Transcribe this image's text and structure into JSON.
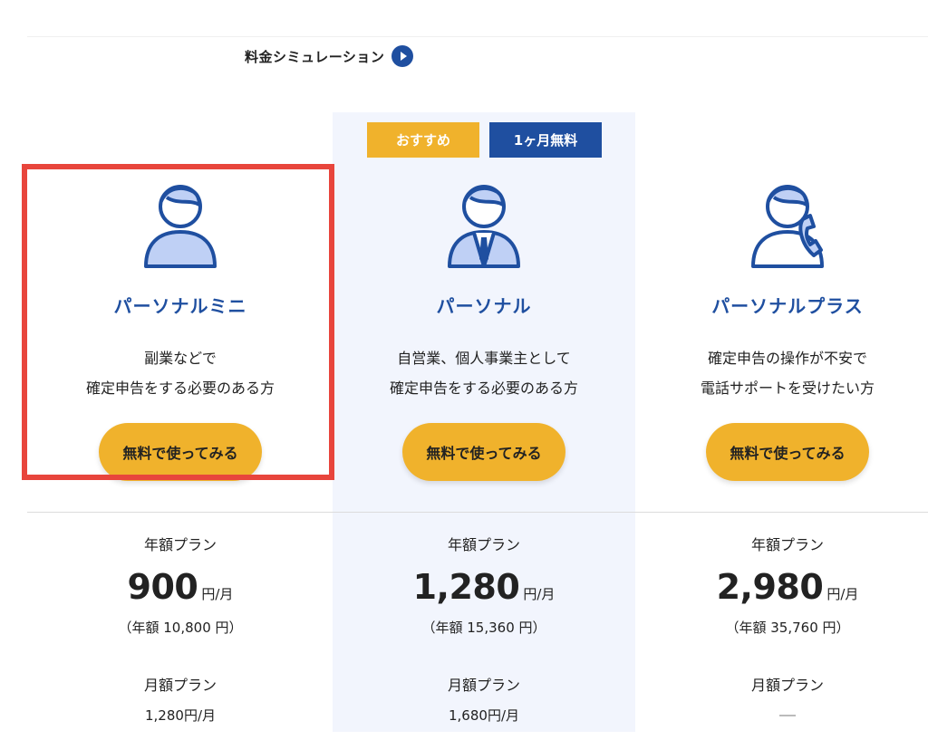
{
  "header": {
    "simulation_link": "料金シミュレーション",
    "icon": "play-circle-icon"
  },
  "badges": {
    "recommended": "おすすめ",
    "free_month": "1ヶ月無料"
  },
  "colors": {
    "brand_blue": "#1f4fa0",
    "accent_yellow": "#f0b22c",
    "highlight_red": "#e8453c",
    "highlight_bg": "#f2f5fd"
  },
  "plans": [
    {
      "name": "パーソナルミニ",
      "desc_line1": "副業などで",
      "desc_line2": "確定申告をする必要のある方",
      "cta": "無料で使ってみる",
      "icon": "person-icon",
      "annual_label": "年額プラン",
      "annual_monthly_price": "900",
      "unit": "円/月",
      "annual_total": "（年額 10,800 円）",
      "monthly_label": "月額プラン",
      "monthly_price": "1,280円/月"
    },
    {
      "name": "パーソナル",
      "desc_line1": "自営業、個人事業主として",
      "desc_line2": "確定申告をする必要のある方",
      "cta": "無料で使ってみる",
      "icon": "businessman-icon",
      "annual_label": "年額プラン",
      "annual_monthly_price": "1,280",
      "unit": "円/月",
      "annual_total": "（年額 15,360 円）",
      "monthly_label": "月額プラン",
      "monthly_price": "1,680円/月"
    },
    {
      "name": "パーソナルプラス",
      "desc_line1": "確定申告の操作が不安で",
      "desc_line2": "電話サポートを受けたい方",
      "cta": "無料で使ってみる",
      "icon": "person-phone-icon",
      "annual_label": "年額プラン",
      "annual_monthly_price": "2,980",
      "unit": "円/月",
      "annual_total": "（年額 35,760 円）",
      "monthly_label": "月額プラン",
      "monthly_price": "—"
    }
  ]
}
